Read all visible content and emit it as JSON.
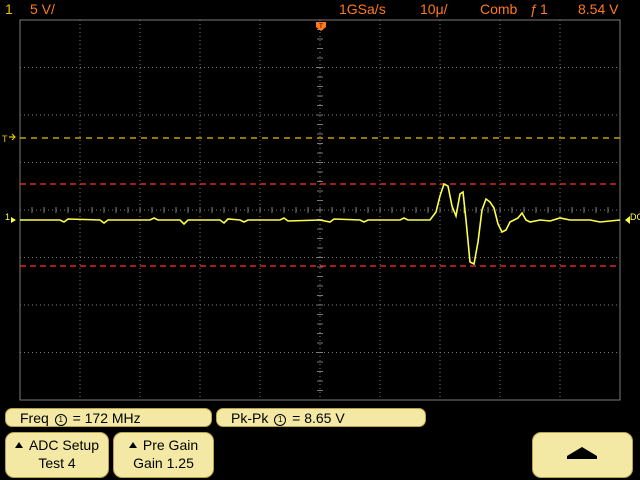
{
  "topbar": {
    "channel_number": "1",
    "volts_per_div": "5 V/",
    "sample_rate": "1GSa/s",
    "time_per_div": "10μ/",
    "trigger_mode": "Comb",
    "trigger_edge_symbol": "ƒ",
    "trigger_channel": "1",
    "trigger_level": "8.54 V"
  },
  "markers": {
    "trigger_time_marker": "T",
    "trigger_level_marker": "T",
    "channel_ground_marker": "1",
    "coupling_marker": "DC"
  },
  "measurements": {
    "freq_label": "Freq",
    "freq_channel_symbol": "1",
    "freq_value": "= 172 MHz",
    "pkpk_label": "Pk-Pk",
    "pkpk_channel_symbol": "1",
    "pkpk_value": "=  8.65  V"
  },
  "softkeys": [
    {
      "line1": "ADC Setup",
      "line2": "Test 4"
    },
    {
      "line1": "Pre Gain",
      "line2": "Gain 1.25"
    }
  ],
  "colors": {
    "trace": "#ffff4a",
    "grid": "#7a7a7a",
    "trigger_line": "#e8c000",
    "cursor_lines": "#ff3030",
    "panel": "#f3e9a4",
    "text_yellow": "#e8c000",
    "text_orange": "#ff7a1a"
  },
  "icons": {
    "softkey_arrow": "up-triangle-icon",
    "return_button": "up-arrow-icon"
  }
}
